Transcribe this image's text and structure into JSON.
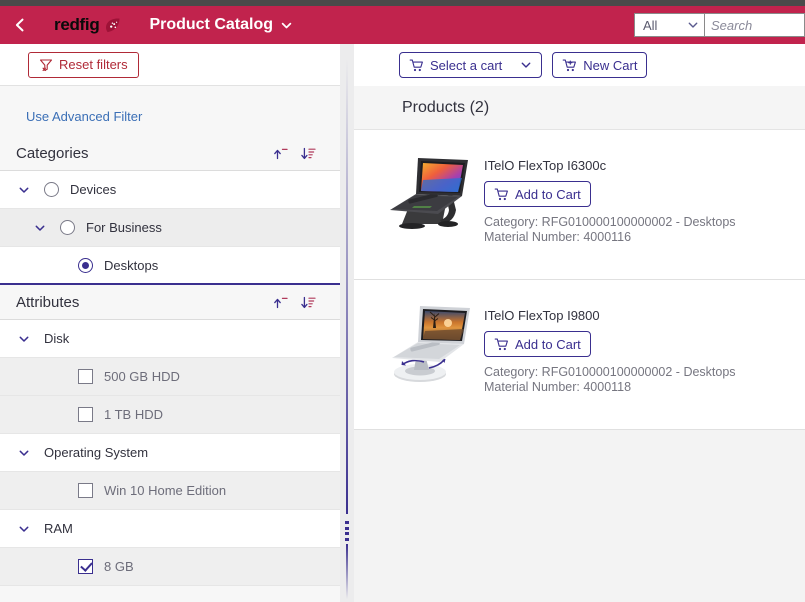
{
  "header": {
    "back_icon": "chevron-left-icon",
    "brand_text": "redfig",
    "brand_mark_icon": "redfig-leaf-logo",
    "app_title": "Product Catalog",
    "app_title_chevron": "chevron-down-icon",
    "search_scope_value": "All",
    "search_scope_chevron": "chevron-down-icon",
    "search_placeholder": "Search",
    "search_value": ""
  },
  "filters": {
    "reset_label": "Reset filters",
    "reset_icon": "filter-clear-icon",
    "advanced_filter_label": "Use Advanced Filter",
    "categories": {
      "title": "Categories",
      "collapse_icon": "collapse-up-icon",
      "sort_icon": "sort-descending-icon",
      "items": [
        {
          "label": "Devices",
          "level": 0,
          "control": "radio",
          "checked": false,
          "expanded": true
        },
        {
          "label": "For Business",
          "level": 1,
          "control": "radio",
          "checked": false,
          "expanded": true
        },
        {
          "label": "Desktops",
          "level": 2,
          "control": "radio",
          "checked": true,
          "expanded": null
        }
      ]
    },
    "attributes": {
      "title": "Attributes",
      "collapse_icon": "collapse-up-icon",
      "sort_icon": "sort-descending-icon",
      "groups": [
        {
          "label": "Disk",
          "expanded": true,
          "values": [
            {
              "label": "500 GB HDD",
              "checked": false
            },
            {
              "label": "1 TB HDD",
              "checked": false
            }
          ]
        },
        {
          "label": "Operating System",
          "expanded": true,
          "values": [
            {
              "label": "Win 10 Home Edition",
              "checked": false
            }
          ]
        },
        {
          "label": "RAM",
          "expanded": true,
          "values": [
            {
              "label": "8 GB",
              "checked": true
            }
          ]
        }
      ]
    }
  },
  "splitter": {
    "grip_icon": "splitter-grip-icon"
  },
  "content": {
    "select_cart_label": "Select a cart",
    "select_cart_icon": "cart-icon",
    "select_cart_chevron": "chevron-down-icon",
    "new_cart_label": "New Cart",
    "new_cart_icon": "cart-plus-icon",
    "products_heading": "Products (2)",
    "add_to_cart_label": "Add to Cart",
    "add_to_cart_icon": "cart-icon",
    "category_prefix": "Category: ",
    "material_prefix": "Material Number: ",
    "products": [
      {
        "name": "ITelO FlexTop I6300c",
        "category_line": "Category: RFG010000100000002 - Desktops",
        "material_line": "Material Number: 4000116",
        "image_icon": "laptop-on-black-stand-image",
        "add_to_cart_label": "Add to Cart"
      },
      {
        "name": "ITelO FlexTop I9800",
        "category_line": "Category: RFG010000100000002 - Desktops",
        "material_line": "Material Number: 4000118",
        "image_icon": "laptop-on-silver-stand-image",
        "add_to_cart_label": "Add to Cart"
      }
    ]
  },
  "colors": {
    "brand_crimson": "#c1234d",
    "accent_indigo": "#3a2f8f",
    "reset_red": "#b02a37",
    "link_blue": "#3b6fb6",
    "top_strip": "#4a4a4a"
  }
}
